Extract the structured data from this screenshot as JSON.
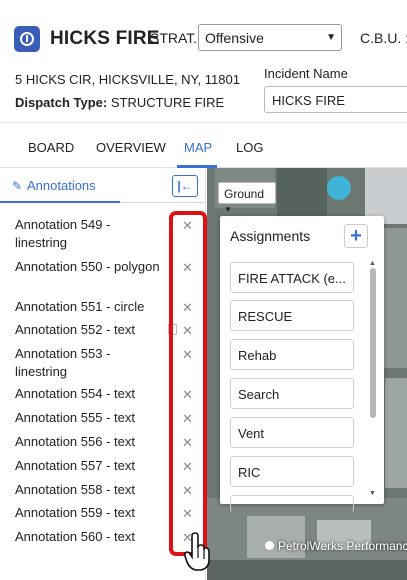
{
  "header": {
    "title": "HICKS FIRE",
    "strat_label": "STRAT.",
    "strat_value": "Offensive",
    "cbu_label": "C.B.U. :",
    "address": "5 HICKS CIR, HICKSVILLE, NY, 11801",
    "dispatch_label": "Dispatch Type:",
    "dispatch_value": "STRUCTURE FIRE",
    "incident_name_label": "Incident Name",
    "incident_name_value": "HICKS FIRE"
  },
  "tabs": [
    {
      "label": "BOARD"
    },
    {
      "label": "OVERVIEW"
    },
    {
      "label": "MAP",
      "active": true
    },
    {
      "label": "LOG"
    }
  ],
  "sidebar": {
    "tab_label": "Annotations",
    "collapse_icon": "collapse-left-icon",
    "annotations": [
      {
        "label": "Annotation 549 - linestring"
      },
      {
        "label": "Annotation 550 - polygon"
      },
      {
        "label": "Annotation 551 - circle"
      },
      {
        "label": "Annotation 552 - text"
      },
      {
        "label": "Annotation 553 - linestring"
      },
      {
        "label": "Annotation 554 - text"
      },
      {
        "label": "Annotation 555 - text"
      },
      {
        "label": "Annotation 556 - text"
      },
      {
        "label": "Annotation 557 - text"
      },
      {
        "label": "Annotation 558 - text"
      },
      {
        "label": "Annotation 559 - text"
      },
      {
        "label": "Annotation 560 - text"
      }
    ],
    "delete_glyph": "✕"
  },
  "map": {
    "layer_button": "Ground",
    "place_label": "PetrolWerks Performance",
    "assignments": {
      "title": "Assignments",
      "add_glyph": "+",
      "items": [
        {
          "label": "FIRE ATTACK (e..."
        },
        {
          "label": "RESCUE"
        },
        {
          "label": "Rehab"
        },
        {
          "label": "Search"
        },
        {
          "label": "Vent"
        },
        {
          "label": "RIC"
        }
      ]
    }
  },
  "colors": {
    "accent": "#3a6fd8",
    "logo": "#3a5db8",
    "highlight": "#dd1111"
  }
}
